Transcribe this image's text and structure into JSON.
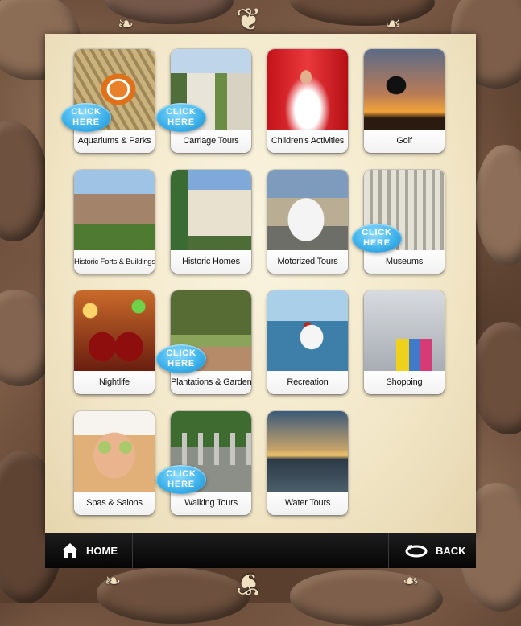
{
  "tiles": [
    {
      "label": "Aquariums & Parks",
      "photo": "clownfish-anemone",
      "click_here": true
    },
    {
      "label": "Carriage Tours",
      "photo": "horse-carriage-street",
      "click_here": true
    },
    {
      "label": "Children's Activities",
      "photo": "child-waterslide",
      "click_here": false
    },
    {
      "label": "Golf",
      "photo": "golfer-sunset-silhouette",
      "click_here": false
    },
    {
      "label": "Historic Forts & Buildings",
      "photo": "brick-fort",
      "click_here": false
    },
    {
      "label": "Historic Homes",
      "photo": "palms-historic-house",
      "click_here": false
    },
    {
      "label": "Motorized Tours",
      "photo": "tour-shuttle-bus",
      "click_here": false
    },
    {
      "label": "Museums",
      "photo": "columned-museum",
      "click_here": true
    },
    {
      "label": "Nightlife",
      "photo": "wine-glasses-toast",
      "click_here": false
    },
    {
      "label": "Plantations & Gardens",
      "photo": "oak-alley",
      "click_here": true
    },
    {
      "label": "Recreation",
      "photo": "jet-ski",
      "click_here": false
    },
    {
      "label": "Shopping",
      "photo": "shopping-bags",
      "click_here": false
    },
    {
      "label": "Spas & Salons",
      "photo": "spa-cucumber-face",
      "click_here": false
    },
    {
      "label": "Walking Tours",
      "photo": "walking-tour-group",
      "click_here": true
    },
    {
      "label": "Water Tours",
      "photo": "harbor-sunset-sailboats",
      "click_here": false
    }
  ],
  "click_here_text": [
    "CLICK",
    "HERE"
  ],
  "footer": {
    "home_label": "HOME",
    "back_label": "BACK"
  }
}
